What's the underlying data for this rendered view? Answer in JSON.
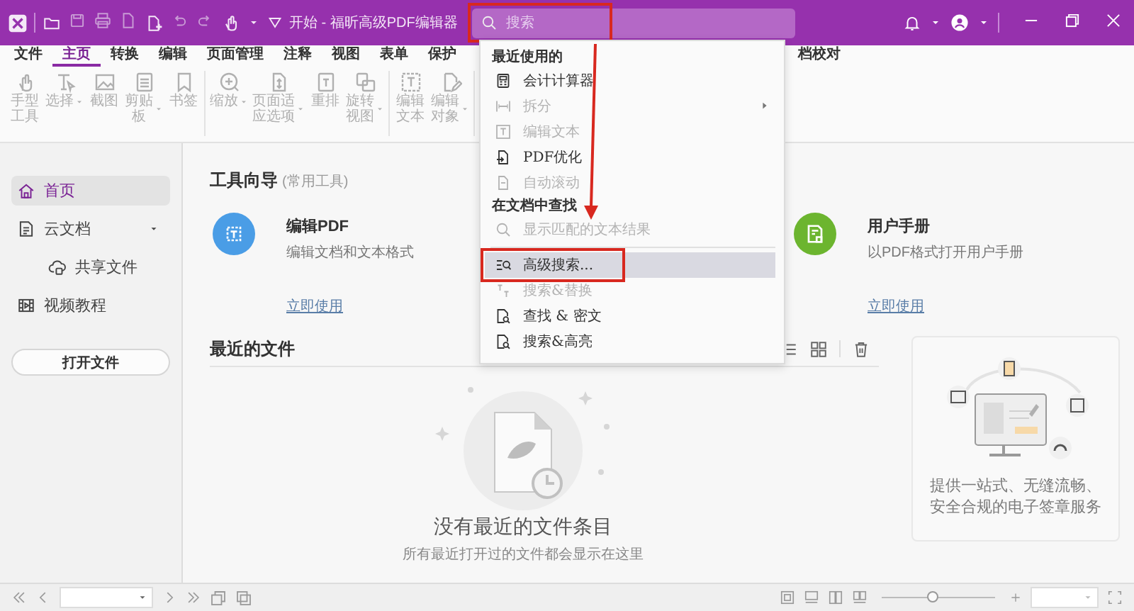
{
  "window": {
    "title": "开始 - 福昕高级PDF编辑器"
  },
  "search": {
    "placeholder": "搜索",
    "annotated": true
  },
  "menu_tabs": [
    {
      "label": "文件",
      "selected": false
    },
    {
      "label": "主页",
      "selected": true
    },
    {
      "label": "转换",
      "selected": false
    },
    {
      "label": "编辑",
      "selected": false
    },
    {
      "label": "页面管理",
      "selected": false
    },
    {
      "label": "注释",
      "selected": false
    },
    {
      "label": "视图",
      "selected": false
    },
    {
      "label": "表单",
      "selected": false
    },
    {
      "label": "保护",
      "selected": false
    },
    {
      "label": "档校对",
      "selected": false
    }
  ],
  "ribbon": {
    "groups": [
      {
        "tools": [
          {
            "kind": "hand",
            "label": "手型工具",
            "has_menu": false,
            "disabled": true
          },
          {
            "kind": "select",
            "label": "选择",
            "has_menu": true,
            "disabled": true
          },
          {
            "kind": "screenshot",
            "label": "截图",
            "has_menu": false,
            "disabled": true
          },
          {
            "kind": "clipboard",
            "label": "剪贴板",
            "has_menu": true,
            "disabled": true
          },
          {
            "kind": "bookmark",
            "label": "书签",
            "has_menu": false,
            "disabled": true
          }
        ]
      },
      {
        "tools": [
          {
            "kind": "zoom",
            "label": "缩放",
            "has_menu": true,
            "disabled": true
          },
          {
            "kind": "fit",
            "label": "页面适应选项",
            "has_menu": true,
            "disabled": true
          },
          {
            "kind": "reflow",
            "label": "重排",
            "has_menu": false,
            "disabled": true
          },
          {
            "kind": "rotate",
            "label": "旋转视图",
            "has_menu": true,
            "disabled": true
          }
        ]
      },
      {
        "tools": [
          {
            "kind": "edit_text",
            "label": "编辑文本",
            "has_menu": false,
            "disabled": true
          },
          {
            "kind": "edit_object",
            "label": "编辑对象",
            "has_menu": true,
            "disabled": true
          }
        ]
      }
    ]
  },
  "sidebar": {
    "items": [
      {
        "kind": "home",
        "label": "首页",
        "selected": true
      },
      {
        "kind": "cloud_doc",
        "label": "云文档",
        "selected": false,
        "expanded": true,
        "children": [
          {
            "kind": "share",
            "label": "共享文件",
            "selected": false
          }
        ]
      },
      {
        "kind": "video",
        "label": "视频教程",
        "selected": false
      }
    ],
    "open_button": "打开文件"
  },
  "tool_guide": {
    "title": "工具向导",
    "subtitle": "(常用工具)",
    "cards": [
      {
        "kind": "edit",
        "title": "编辑PDF",
        "description": "编辑文档和文本格式",
        "link": "立即使用",
        "color": "#4a9de6"
      },
      {
        "kind": "manual",
        "title": "用户手册",
        "description": "以PDF格式打开用户手册",
        "link": "立即使用",
        "color": "#6cb52f"
      }
    ]
  },
  "recent_files": {
    "title": "最近的文件",
    "empty_title": "没有最近的文件条目",
    "empty_text": "所有最近打开过的文件都会显示在这里"
  },
  "promo": {
    "text": "提供一站式、无缝流畅、安全合规的电子签章服务"
  },
  "search_menu": {
    "sections": [
      {
        "title": "最近使用的",
        "items": [
          {
            "kind": "calculator",
            "label": "会计计算器",
            "disabled": false,
            "selected": false,
            "has_submenu": false,
            "annotated": false
          },
          {
            "kind": "split",
            "label": "拆分",
            "disabled": true,
            "selected": false,
            "has_submenu": true,
            "annotated": false
          },
          {
            "kind": "edit_text",
            "label": "编辑文本",
            "disabled": true,
            "selected": false,
            "has_submenu": false,
            "annotated": false
          },
          {
            "kind": "optimize",
            "label": "PDF优化",
            "disabled": false,
            "selected": false,
            "has_submenu": false,
            "annotated": false
          },
          {
            "kind": "scroll",
            "label": "自动滚动",
            "disabled": true,
            "selected": false,
            "has_submenu": false,
            "annotated": false
          }
        ]
      },
      {
        "title": "在文档中查找",
        "items": [
          {
            "kind": "search",
            "label": "显示匹配的文本结果",
            "disabled": true,
            "selected": false,
            "has_submenu": false,
            "annotated": false
          }
        ]
      },
      {
        "items": [
          {
            "kind": "advanced_search",
            "label": "高级搜索...",
            "disabled": false,
            "selected": true,
            "has_submenu": false,
            "annotated": true
          },
          {
            "kind": "replace",
            "label": "搜索&替换",
            "disabled": true,
            "selected": false,
            "has_submenu": false,
            "annotated": false
          },
          {
            "kind": "redact",
            "label": "查找 & 密文",
            "disabled": false,
            "selected": false,
            "has_submenu": false,
            "annotated": false
          },
          {
            "kind": "highlight",
            "label": "搜索&高亮",
            "disabled": false,
            "selected": false,
            "has_submenu": false,
            "annotated": false
          }
        ]
      }
    ]
  },
  "status_bar": {
    "zoom": {
      "level": 0.45
    }
  },
  "annotation": {
    "arrow": true
  }
}
